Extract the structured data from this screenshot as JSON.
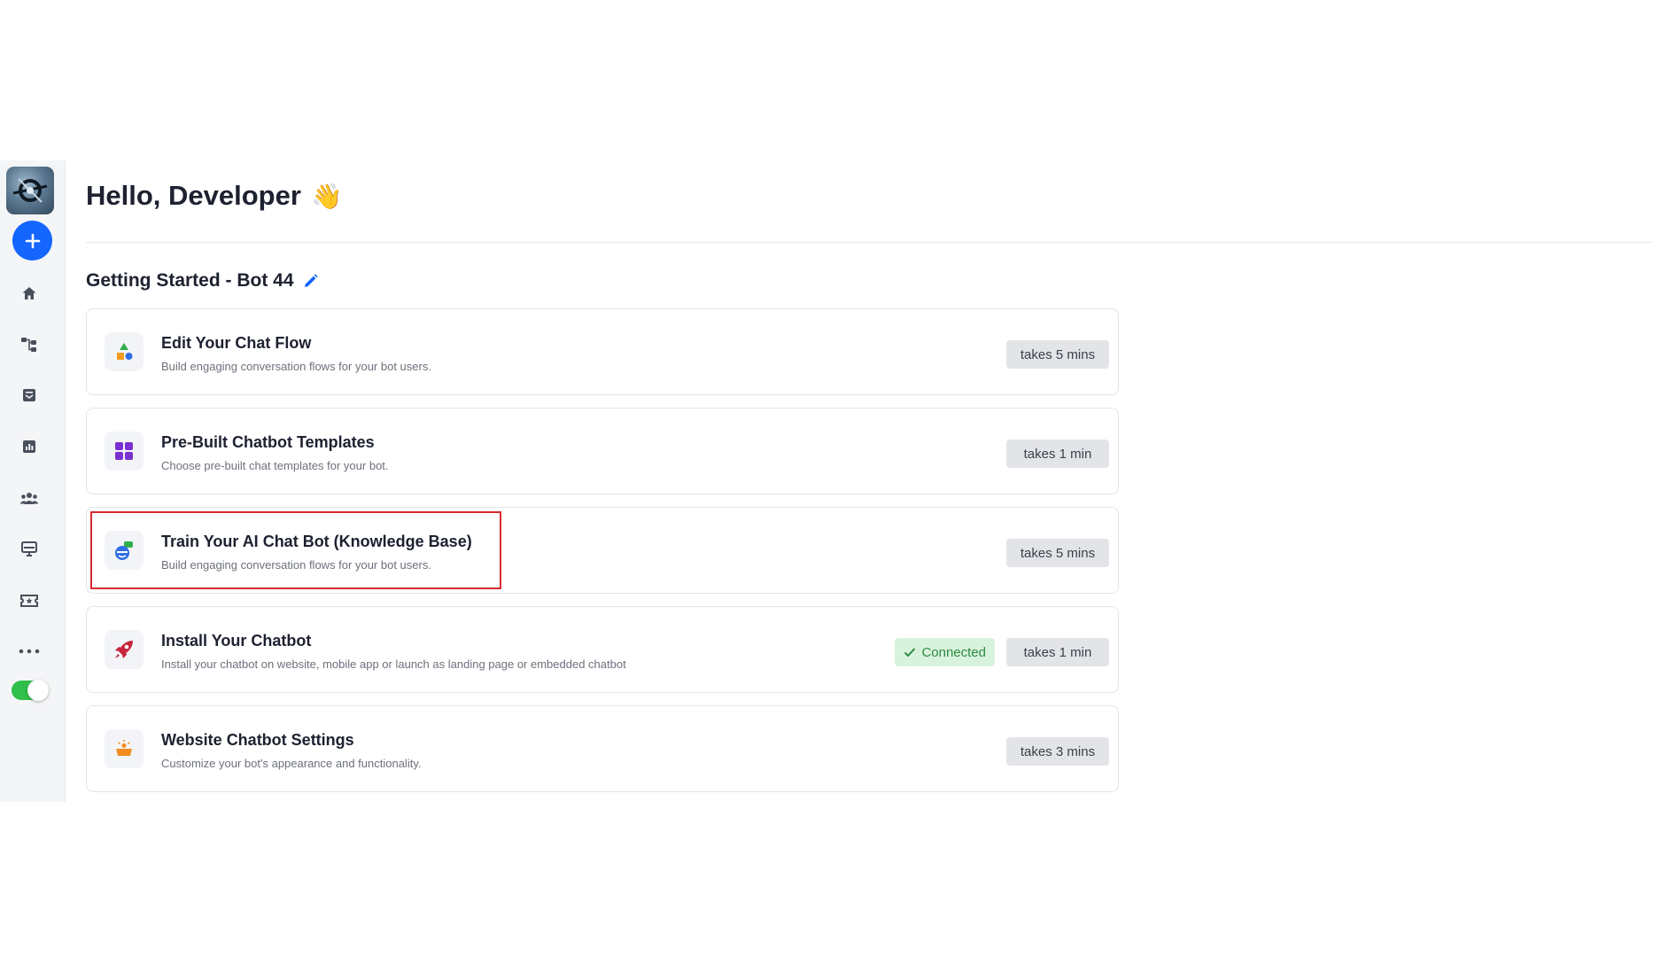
{
  "header": {
    "greeting": "Hello, Developer",
    "greeting_emoji": "👋"
  },
  "section": {
    "title": "Getting Started - Bot 44"
  },
  "cards": [
    {
      "title": "Edit Your Chat Flow",
      "description": "Build engaging conversation flows for your bot users.",
      "time": "takes 5 mins",
      "icon": "shapes-icon"
    },
    {
      "title": "Pre-Built Chatbot Templates",
      "description": "Choose pre-built chat templates for your bot.",
      "time": "takes 1 min",
      "icon": "grid-icon"
    },
    {
      "title": "Train Your AI Chat Bot (Knowledge Base)",
      "description": "Build engaging conversation flows for your bot users.",
      "time": "takes 5 mins",
      "icon": "ai-brain-icon",
      "highlighted": true
    },
    {
      "title": "Install Your Chatbot",
      "description": "Install your chatbot on website, mobile app or launch as landing page or embedded chatbot",
      "time": "takes 1 min",
      "status": "Connected",
      "icon": "rocket-icon"
    },
    {
      "title": "Website Chatbot Settings",
      "description": "Customize your bot's appearance and functionality.",
      "time": "takes 3 mins",
      "icon": "settings-widget-icon"
    }
  ],
  "sidebar": {
    "items": [
      {
        "icon": "home-icon"
      },
      {
        "icon": "flow-icon"
      },
      {
        "icon": "inbox-icon"
      },
      {
        "icon": "analytics-icon"
      },
      {
        "icon": "users-icon"
      },
      {
        "icon": "desktop-icon"
      },
      {
        "icon": "ticket-icon"
      },
      {
        "icon": "more-icon"
      }
    ],
    "toggle_on": true
  },
  "colors": {
    "accent": "#1565ff",
    "toggle": "#2fbf4a",
    "connected_bg": "#d8f3dd",
    "connected_text": "#2e8a43",
    "highlight": "#d8292f"
  }
}
